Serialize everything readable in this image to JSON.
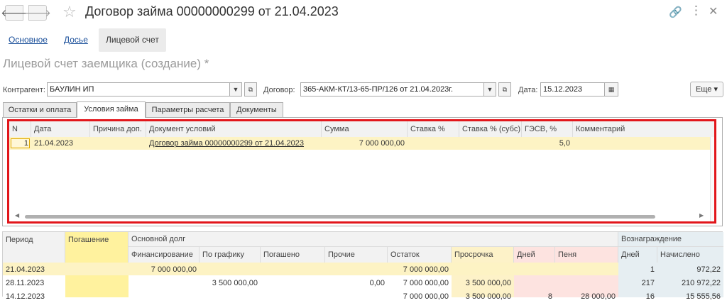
{
  "window": {
    "title": "Договор займа 00000000299 от 21.04.2023"
  },
  "form_tabs": [
    "Основное",
    "Досье",
    "Лицевой счет"
  ],
  "subtitle": "Лицевой счет заемщика (создание) *",
  "fields": {
    "counterparty_label": "Контрагент:",
    "counterparty_value": "БАУЛИН ИП",
    "contract_label": "Договор:",
    "contract_value": "365-АКМ-КТ/13-65-ПР/126 от 21.04.2023г.",
    "date_label": "Дата:",
    "date_value": "15.12.2023",
    "more_label": "Еще ▾"
  },
  "page_tabs": [
    "Остатки и оплата",
    "Условия займа",
    "Параметры расчета",
    "Документы"
  ],
  "conditions_table": {
    "headers": [
      "N",
      "Дата",
      "Причина доп.",
      "Документ условий",
      "Сумма",
      "Ставка %",
      "Ставка % (субс)",
      "ГЭСВ, %",
      "Комментарий"
    ],
    "rows": [
      [
        "1",
        "21.04.2023",
        "",
        "Договор займа 00000000299 от 21.04.2023",
        "7 000 000,00",
        "",
        "",
        "5,0",
        ""
      ]
    ]
  },
  "schedule_table": {
    "headers": {
      "period": "Период",
      "repayment": "Погашение",
      "principal_group": "Основной долг",
      "financing": "Финансирование",
      "scheduled": "По графику",
      "repaid": "Погашено",
      "other": "Прочие",
      "balance": "Остаток",
      "overdue": "Просрочка",
      "days": "Дней",
      "penalty": "Пеня",
      "reward_group": "Вознаграждение",
      "reward_days": "Дней",
      "accrued": "Начислено"
    },
    "rows": [
      {
        "period": "21.04.2023",
        "financing": "7 000 000,00",
        "scheduled": "",
        "repaid": "",
        "other": "",
        "balance": "7 000 000,00",
        "overdue": "",
        "days": "",
        "penalty": "",
        "reward_days": "1",
        "accrued": "972,22"
      },
      {
        "period": "28.11.2023",
        "financing": "",
        "scheduled": "3 500 000,00",
        "repaid": "",
        "other": "0,00",
        "balance": "7 000 000,00",
        "overdue": "3 500 000,00",
        "days": "",
        "penalty": "",
        "reward_days": "217",
        "accrued": "210 972,22"
      },
      {
        "period": "14.12.2023",
        "financing": "",
        "scheduled": "",
        "repaid": "",
        "other": "",
        "balance": "7 000 000,00",
        "overdue": "3 500 000,00",
        "days": "8",
        "penalty": "28 000,00",
        "reward_days": "16",
        "accrued": "15 555,56"
      }
    ]
  },
  "colors": {
    "highlight_row": "#fdf3c4",
    "repayment_col": "#fff29e",
    "overdue_col": "#fdf2c8",
    "penalty_col": "#fde3e0",
    "reward_col": "#e6eef2",
    "selection_frame": "#e2161b"
  }
}
